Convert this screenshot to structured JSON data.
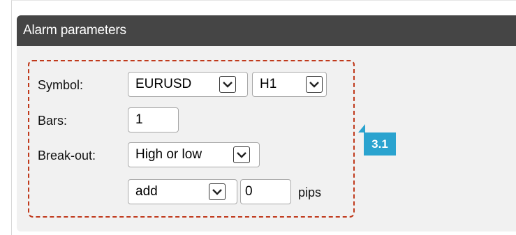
{
  "panel": {
    "title": "Alarm parameters"
  },
  "form": {
    "symbol_label": "Symbol:",
    "symbol_value": "EURUSD",
    "timeframe_value": "H1",
    "bars_label": "Bars:",
    "bars_value": "1",
    "breakout_label": "Break-out:",
    "breakout_value": "High or low",
    "offset_mode_value": "add",
    "offset_amount_value": "0",
    "offset_unit_label": "pips"
  },
  "callout": {
    "label": "3.1",
    "color": "#2aa3cf"
  },
  "colors": {
    "header_bg": "#454545",
    "panel_bg": "#f1f1f1",
    "highlight_border": "#c0391b"
  },
  "icons": {
    "dropdown": "chevron-down-icon"
  }
}
